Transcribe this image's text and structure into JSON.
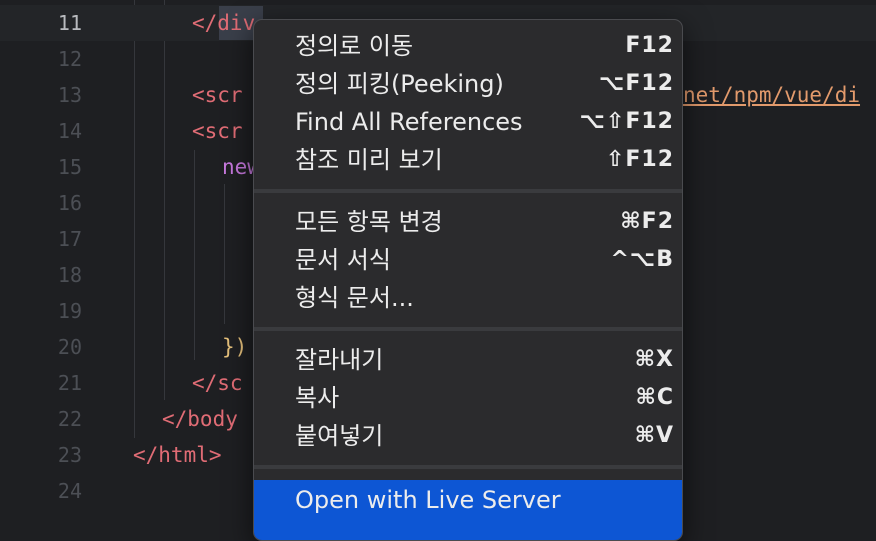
{
  "editor": {
    "lines": [
      {
        "num": "11",
        "code": "</div"
      },
      {
        "num": "12",
        "code": ""
      },
      {
        "num": "13",
        "code": "<scr",
        "tail": "net/npm/vue/di"
      },
      {
        "num": "14",
        "code": "<scr"
      },
      {
        "num": "15",
        "code": "new"
      },
      {
        "num": "16",
        "code": ""
      },
      {
        "num": "17",
        "code": ""
      },
      {
        "num": "18",
        "code": ""
      },
      {
        "num": "19",
        "code": ""
      },
      {
        "num": "20",
        "code": "})"
      },
      {
        "num": "21",
        "code": "</sc"
      },
      {
        "num": "22",
        "code": "</body"
      },
      {
        "num": "23",
        "code": "</html>"
      },
      {
        "num": "24",
        "code": ""
      }
    ]
  },
  "menu": {
    "groups": [
      [
        {
          "label": "정의로 이동",
          "shortcut": "F12"
        },
        {
          "label": "정의 피킹(Peeking)",
          "shortcut": "⌥F12"
        },
        {
          "label": "Find All References",
          "shortcut": "⌥⇧F12"
        },
        {
          "label": "참조 미리 보기",
          "shortcut": "⇧F12"
        }
      ],
      [
        {
          "label": "모든 항목 변경",
          "shortcut": "⌘F2"
        },
        {
          "label": "문서 서식",
          "shortcut": "^⌥B"
        },
        {
          "label": "형식 문서...",
          "shortcut": ""
        }
      ],
      [
        {
          "label": "잘라내기",
          "shortcut": "⌘X"
        },
        {
          "label": "복사",
          "shortcut": "⌘C"
        },
        {
          "label": "붙여넣기",
          "shortcut": "⌘V"
        }
      ],
      [
        {
          "label": "Open with Live Server",
          "shortcut": ""
        }
      ]
    ]
  },
  "colors": {
    "menu_selected": "#0d56d4",
    "tag": "#e06c75",
    "keyword": "#c678dd"
  }
}
